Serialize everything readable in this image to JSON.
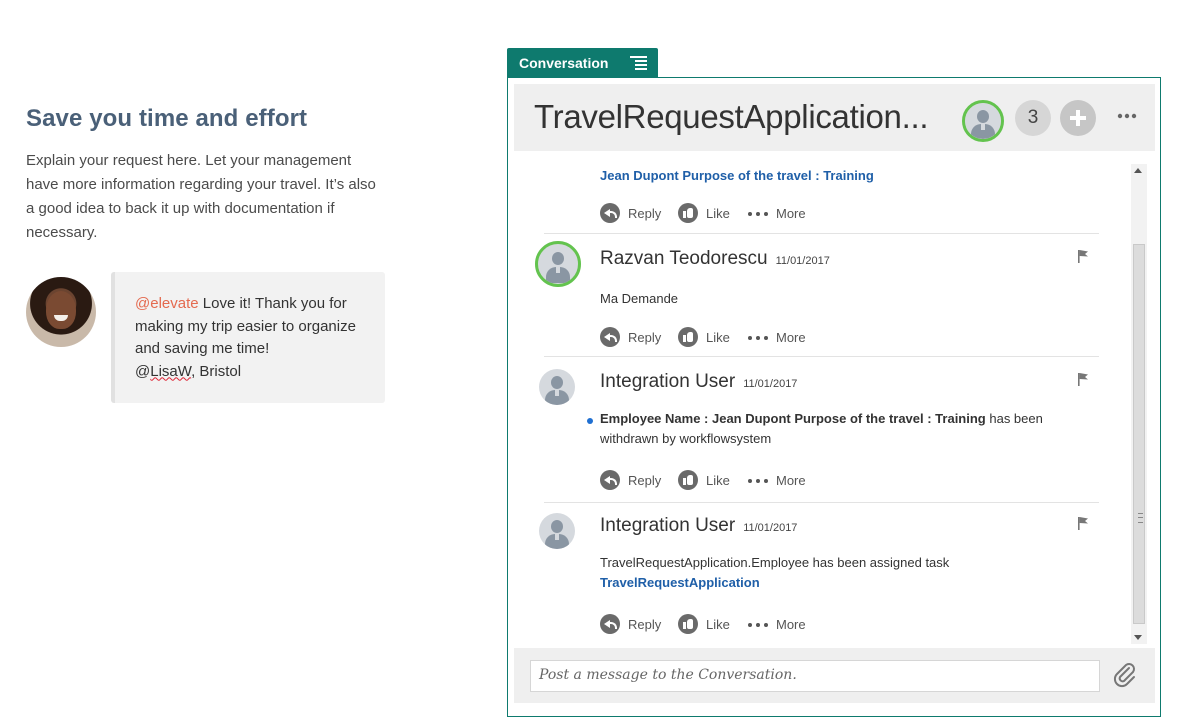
{
  "left": {
    "heading": "Save you time and effort",
    "paragraph": "Explain your request here. Let your management have more information regarding your travel. It’s also a good idea to back it up with documentation if necessary.",
    "testimonial": {
      "mention": "@elevate",
      "text": " Love it! Thank you for making my trip easier to organize and saving me time!",
      "author_prefix": " @",
      "author_handle": "LisaW",
      "author_suffix": ", Bristol"
    }
  },
  "conversation": {
    "tab_label": "Conversation",
    "title": "TravelRequestApplication...",
    "participant_count": "3",
    "composer_placeholder": "Post a message to the Conversation.",
    "actions": {
      "reply": "Reply",
      "like": "Like",
      "more": "More"
    },
    "messages": [
      {
        "partial_text": "Jean Dupont Purpose of the travel : Training"
      },
      {
        "author": "Razvan Teodorescu",
        "date": "11/01/2017",
        "body": "Ma Demande"
      },
      {
        "author": "Integration User",
        "date": "11/01/2017",
        "body_bold": "Employee Name : Jean Dupont Purpose of the travel : Training",
        "body_rest": " has been withdrawn by workflowsystem"
      },
      {
        "author": "Integration User",
        "date": "11/01/2017",
        "body": "TravelRequestApplication.Employee has been assigned task",
        "link": "TravelRequestApplication"
      }
    ]
  },
  "colors": {
    "accent": "#0e7a6e",
    "heading": "#4a6078",
    "mention": "#e46a4f",
    "link": "#1f5fa8",
    "presence": "#63c34e"
  },
  "icons": [
    "options-list-icon",
    "add-participant-icon",
    "more-icon",
    "reply-icon",
    "like-icon",
    "more-dots-icon",
    "flag-icon",
    "attachment-icon",
    "user-avatar-icon"
  ]
}
